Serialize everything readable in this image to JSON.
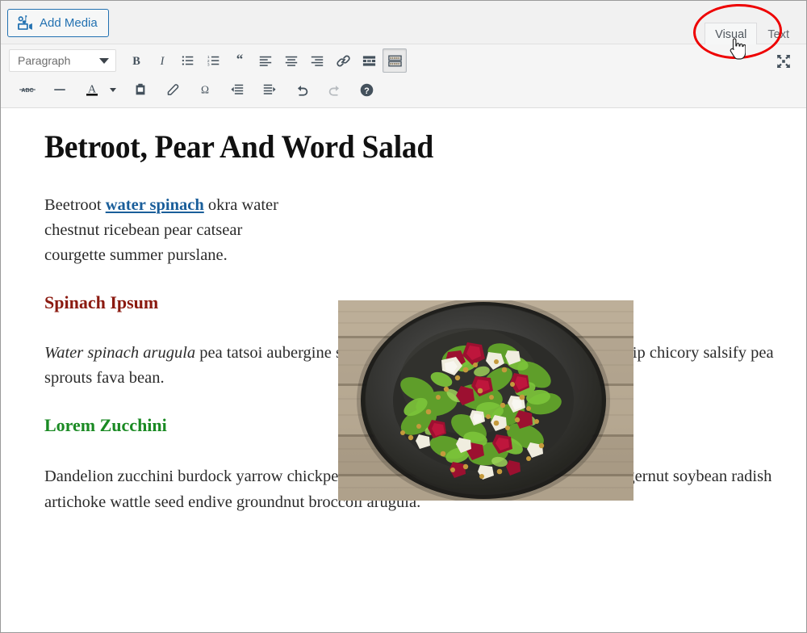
{
  "editor": {
    "add_media_label": "Add Media",
    "add_media_icon": "media-camera-music-icon",
    "tabs": [
      {
        "label": "Visual",
        "active": true,
        "name": "tab-visual"
      },
      {
        "label": "Text",
        "active": false,
        "name": "tab-text"
      }
    ],
    "annotation": {
      "shape": "ellipse",
      "color": "#ee0000",
      "target": "Visual",
      "cursor": "pointing-hand"
    },
    "fullscreen_icon": "fullscreen-expand-icon"
  },
  "toolbar": {
    "format_select": {
      "value": "Paragraph",
      "icon": "chevron-down-icon"
    },
    "row1": [
      {
        "name": "bold-button",
        "label": "Bold",
        "icon": "bold-icon",
        "state": "normal"
      },
      {
        "name": "italic-button",
        "label": "Italic",
        "icon": "italic-icon",
        "state": "normal"
      },
      {
        "name": "bulleted-list-button",
        "label": "Bulleted list",
        "icon": "bulleted-list-icon",
        "state": "normal"
      },
      {
        "name": "numbered-list-button",
        "label": "Numbered list",
        "icon": "numbered-list-icon",
        "state": "normal"
      },
      {
        "name": "blockquote-button",
        "label": "Blockquote",
        "icon": "quote-icon",
        "state": "normal"
      },
      {
        "name": "align-left-button",
        "label": "Align left",
        "icon": "align-left-icon",
        "state": "normal"
      },
      {
        "name": "align-center-button",
        "label": "Align center",
        "icon": "align-center-icon",
        "state": "normal"
      },
      {
        "name": "align-right-button",
        "label": "Align right",
        "icon": "align-right-icon",
        "state": "normal"
      },
      {
        "name": "insert-link-button",
        "label": "Insert/edit link",
        "icon": "link-icon",
        "state": "normal"
      },
      {
        "name": "read-more-button",
        "label": "Insert Read More tag",
        "icon": "read-more-icon",
        "state": "normal"
      },
      {
        "name": "toolbar-toggle-button",
        "label": "Toolbar Toggle",
        "icon": "toolbar-toggle-icon",
        "state": "pressed"
      }
    ],
    "row2": [
      {
        "name": "strikethrough-button",
        "label": "Strikethrough",
        "icon": "strikethrough-abc-icon",
        "state": "normal"
      },
      {
        "name": "horizontal-line-button",
        "label": "Horizontal line",
        "icon": "horizontal-rule-icon",
        "state": "normal"
      },
      {
        "name": "text-color-button",
        "label": "Text color",
        "icon": "text-color-a-icon",
        "state": "normal"
      },
      {
        "name": "text-color-dropdown",
        "label": "Text color options",
        "icon": "chevron-down-icon",
        "state": "normal"
      },
      {
        "name": "paste-as-text-button",
        "label": "Paste as text",
        "icon": "clipboard-icon",
        "state": "normal"
      },
      {
        "name": "clear-formatting-button",
        "label": "Clear formatting",
        "icon": "eraser-icon",
        "state": "normal"
      },
      {
        "name": "special-character-button",
        "label": "Special character",
        "icon": "omega-icon",
        "state": "normal"
      },
      {
        "name": "decrease-indent-button",
        "label": "Decrease indent",
        "icon": "outdent-icon",
        "state": "normal"
      },
      {
        "name": "increase-indent-button",
        "label": "Increase indent",
        "icon": "indent-icon",
        "state": "normal"
      },
      {
        "name": "undo-button",
        "label": "Undo",
        "icon": "undo-arrow-icon",
        "state": "normal"
      },
      {
        "name": "redo-button",
        "label": "Redo",
        "icon": "redo-arrow-icon",
        "state": "disabled"
      },
      {
        "name": "keyboard-shortcuts-button",
        "label": "Keyboard Shortcuts",
        "icon": "help-question-icon",
        "state": "normal"
      }
    ]
  },
  "post": {
    "title": "Betroot, Pear And Word Salad",
    "paragraph1": {
      "before_link": "Beetroot ",
      "link_text": "water spinach",
      "after_link": " okra water chestnut ricebean pear catsear courgette summer purslane."
    },
    "heading_spinach": "Spinach Ipsum",
    "paragraph2": {
      "italic_text": "Water spinach arugula",
      "rest_before_caret": " pea tatsoi aubergine spring onion bush tomato kale radicchio tur",
      "rest_after_caret": "nip chicory salsify pea sprouts fava bean."
    },
    "heading_lorem": "Lorem Zucchini",
    "paragraph3": "Dandelion zucchini burdock yarrow chickpea dandelion sorrel courgette turnip greens tigernut soybean radish artichoke wattle seed endive groundnut broccoli arugula.",
    "image": {
      "alt": "Beetroot pear and watercress salad in a dark bowl on wooden planks",
      "name": "salad-photo"
    }
  },
  "colors": {
    "link": "#1a5e9a",
    "heading_red": "#8b1a10",
    "heading_green": "#1a8a23",
    "accent_blue": "#2271b1",
    "annotation_red": "#ee0000"
  }
}
